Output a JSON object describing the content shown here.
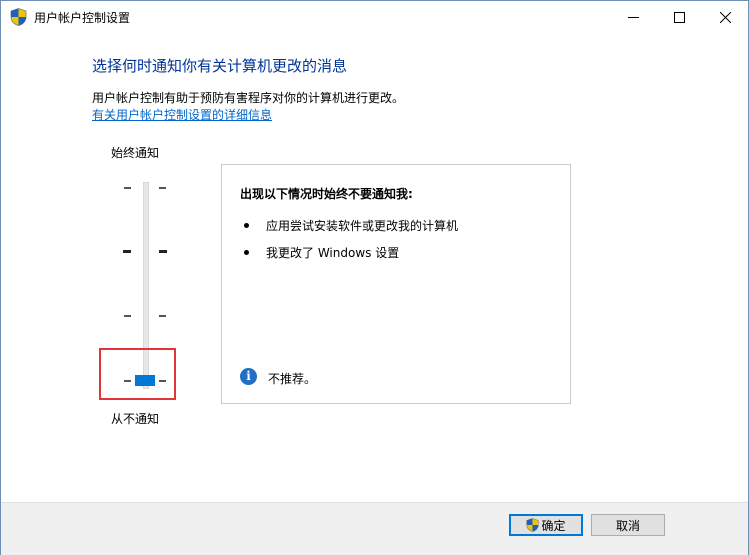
{
  "window": {
    "title": "用户帐户控制设置",
    "title_icon": "uac-shield-icon"
  },
  "content": {
    "heading": "选择何时通知你有关计算机更改的消息",
    "description": "用户帐户控制有助于预防有害程序对你的计算机进行更改。",
    "link": "有关用户帐户控制设置的详细信息"
  },
  "slider": {
    "top_label": "始终通知",
    "bottom_label": "从不通知",
    "levels": 4,
    "selected_level": 1
  },
  "panel": {
    "title": "出现以下情况时始终不要通知我:",
    "bullets": [
      "应用尝试安装软件或更改我的计算机",
      "我更改了 Windows 设置"
    ],
    "info_icon": "info-icon",
    "info_text": "不推荐。"
  },
  "buttons": {
    "ok": "确定",
    "cancel": "取消"
  },
  "colors": {
    "heading": "#003399",
    "link": "#0066cc",
    "accent": "#0078d7",
    "highlight": "#e0363a"
  }
}
